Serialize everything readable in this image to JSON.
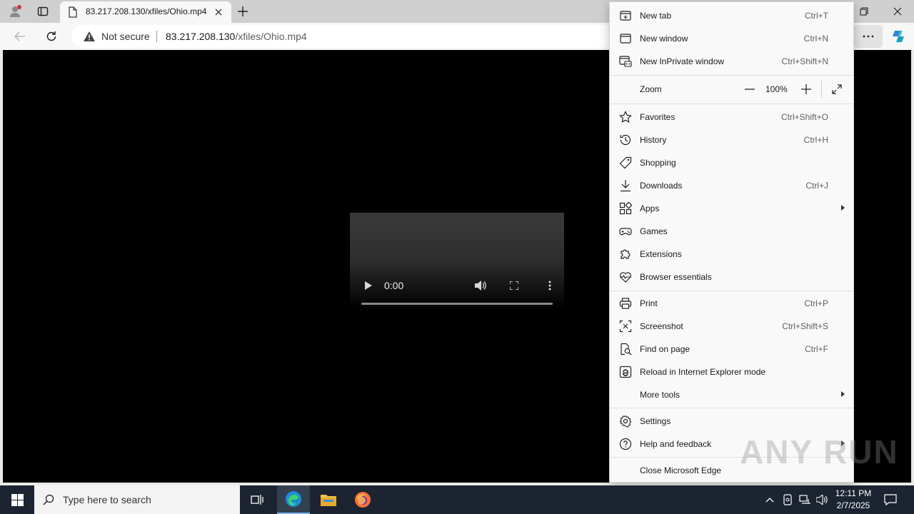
{
  "browser": {
    "tab_title": "83.217.208.130/xfiles/Ohio.mp4",
    "security_label": "Not secure",
    "url_host": "83.217.208.130",
    "url_path": "/xfiles/Ohio.mp4"
  },
  "video": {
    "time": "0:00"
  },
  "menu": {
    "items_top": [
      {
        "label": "New tab",
        "shortcut": "Ctrl+T",
        "icon": "new-tab-icon"
      },
      {
        "label": "New window",
        "shortcut": "Ctrl+N",
        "icon": "new-window-icon"
      },
      {
        "label": "New InPrivate window",
        "shortcut": "Ctrl+Shift+N",
        "icon": "inprivate-icon"
      }
    ],
    "zoom": {
      "label": "Zoom",
      "value": "100%"
    },
    "items_mid": [
      {
        "label": "Favorites",
        "shortcut": "Ctrl+Shift+O",
        "icon": "star-icon"
      },
      {
        "label": "History",
        "shortcut": "Ctrl+H",
        "icon": "history-icon"
      },
      {
        "label": "Shopping",
        "shortcut": "",
        "icon": "tag-icon"
      },
      {
        "label": "Downloads",
        "shortcut": "Ctrl+J",
        "icon": "download-icon"
      },
      {
        "label": "Apps",
        "shortcut": "",
        "icon": "apps-icon"
      },
      {
        "label": "Games",
        "shortcut": "",
        "icon": "games-icon"
      },
      {
        "label": "Extensions",
        "shortcut": "",
        "icon": "puzzle-icon"
      },
      {
        "label": "Browser essentials",
        "shortcut": "",
        "icon": "heartbeat-icon"
      }
    ],
    "items_tools": [
      {
        "label": "Print",
        "shortcut": "Ctrl+P",
        "icon": "printer-icon"
      },
      {
        "label": "Screenshot",
        "shortcut": "Ctrl+Shift+S",
        "icon": "screenshot-icon"
      },
      {
        "label": "Find on page",
        "shortcut": "Ctrl+F",
        "icon": "find-icon"
      },
      {
        "label": "Reload in Internet Explorer mode",
        "shortcut": "",
        "icon": "ie-icon"
      },
      {
        "label": "More tools",
        "shortcut": "",
        "icon": ""
      }
    ],
    "items_bottom": [
      {
        "label": "Settings",
        "icon": "gear-icon"
      },
      {
        "label": "Help and feedback",
        "icon": "help-icon"
      },
      {
        "label": "Close Microsoft Edge",
        "icon": ""
      }
    ]
  },
  "taskbar": {
    "search_placeholder": "Type here to search",
    "time": "12:11 PM",
    "date": "2/7/2025"
  },
  "watermark": "ANY RUN"
}
